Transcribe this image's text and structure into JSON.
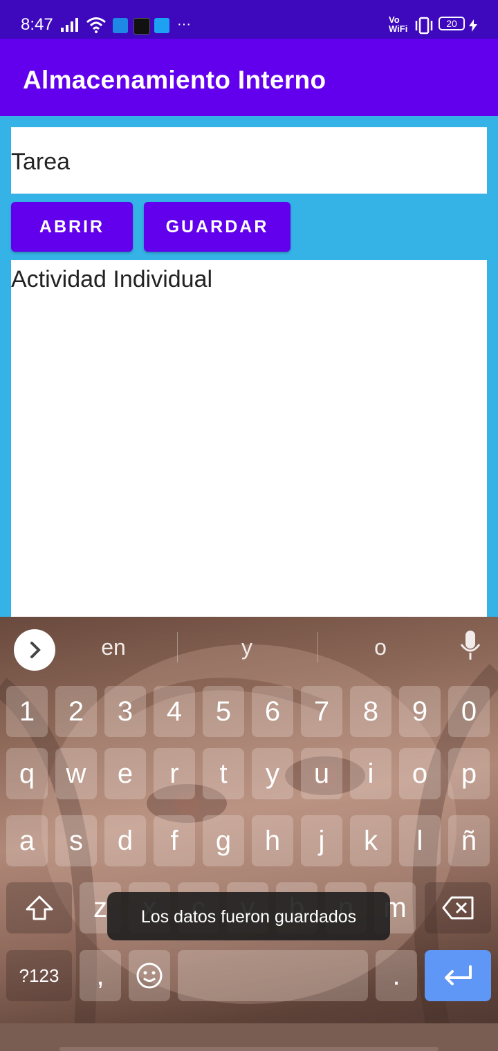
{
  "status_bar": {
    "time": "8:47",
    "vowifi_top": "Vo",
    "vowifi_bottom": "WiFi",
    "battery": "20",
    "more": "···",
    "app_icons": [
      "messages-icon",
      "uber-eats-icon",
      "twitter-icon"
    ]
  },
  "app_bar": {
    "title": "Almacenamiento Interno"
  },
  "form": {
    "filename_value": "Tarea",
    "open_label": "ABRIR",
    "save_label": "GUARDAR",
    "content_value": "Actividad Individual"
  },
  "keyboard": {
    "suggestions": [
      "en",
      "y",
      "o"
    ],
    "row_numbers": [
      "1",
      "2",
      "3",
      "4",
      "5",
      "6",
      "7",
      "8",
      "9",
      "0"
    ],
    "row_1": [
      "q",
      "w",
      "e",
      "r",
      "t",
      "y",
      "u",
      "i",
      "o",
      "p"
    ],
    "row_2": [
      "a",
      "s",
      "d",
      "f",
      "g",
      "h",
      "j",
      "k",
      "l",
      "ñ"
    ],
    "row_3": [
      "z",
      "x",
      "c",
      "v",
      "b",
      "n",
      "m"
    ],
    "symbols_label": "?123",
    "comma": ",",
    "period": "."
  },
  "toast": {
    "message": "Los datos fueron guardados"
  },
  "colors": {
    "status_bar": "#3e09bd",
    "app_bar": "#6200ee",
    "background": "#35b3e6",
    "button": "#6200ee",
    "enter_key": "#5e97f6"
  }
}
